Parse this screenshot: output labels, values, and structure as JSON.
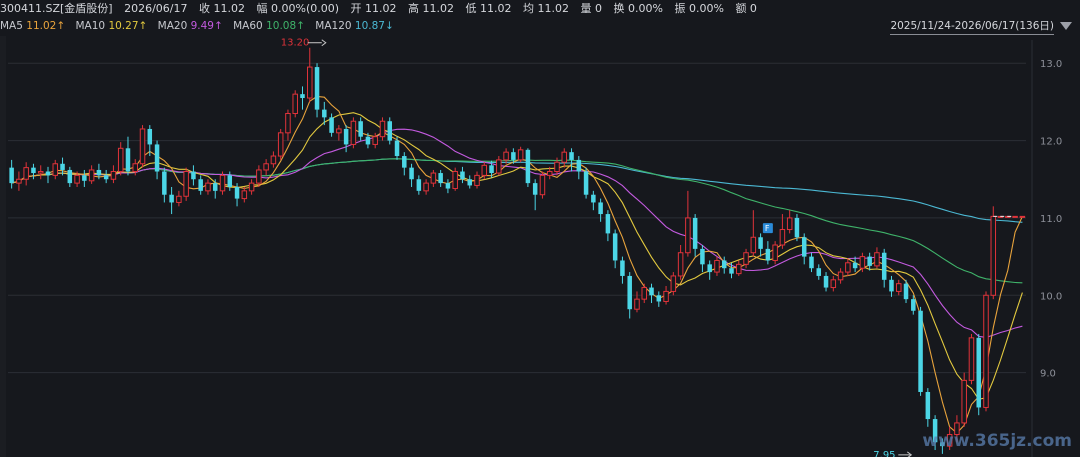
{
  "header": {
    "code": "300411.SZ[金盾股份]",
    "date": "2026/06/17",
    "close": "收 11.02",
    "change": "幅 0.00%(0.00)",
    "open": "开 11.02",
    "high": "高 11.02",
    "low": "低 11.02",
    "avg": "均 11.02",
    "volume": "量 0",
    "turnover": "换 0.00%",
    "amplitude": "振 0.00%",
    "amount": "额 0"
  },
  "ma_legend": [
    {
      "label": "MA5",
      "value": "11.02↑",
      "color": "#e8a33c"
    },
    {
      "label": "MA10",
      "value": "10.27↑",
      "color": "#e2c93f"
    },
    {
      "label": "MA20",
      "value": "9.49↑",
      "color": "#c35adf"
    },
    {
      "label": "MA60",
      "value": "10.08↑",
      "color": "#3fb36a"
    },
    {
      "label": "MA120",
      "value": "10.87↓",
      "color": "#4bb8d3"
    }
  ],
  "range_label": "2025/11/24-2026/06/17(136日)",
  "watermark": "www.365jz.com",
  "colors": {
    "up": "#e0333a",
    "down": "#4cd6e6",
    "grid": "#2b2e35",
    "background": "#16181d"
  },
  "chart_data": {
    "type": "candlestick",
    "ylim": [
      8.0,
      13.3
    ],
    "y_ticks": [
      {
        "value": 13.0,
        "label": "13.0"
      },
      {
        "value": 12.0,
        "label": "12.0"
      },
      {
        "value": 11.0,
        "label": "11.0"
      },
      {
        "value": 10.0,
        "label": "10.0"
      },
      {
        "value": 9.0,
        "label": "9.0"
      }
    ],
    "max_annotation": {
      "value": 13.2,
      "label": "13.20",
      "index": 41
    },
    "min_annotation": {
      "value": 7.95,
      "label": "7.95",
      "index": 124
    },
    "last_price": 11.02,
    "f_marker": {
      "index": 104,
      "label": "F"
    },
    "candles": [
      [
        11.65,
        11.45,
        11.75,
        11.38
      ],
      [
        11.45,
        11.5,
        11.6,
        11.35
      ],
      [
        11.5,
        11.65,
        11.72,
        11.42
      ],
      [
        11.65,
        11.58,
        11.7,
        11.5
      ],
      [
        11.58,
        11.6,
        11.68,
        11.5
      ],
      [
        11.6,
        11.55,
        11.66,
        11.45
      ],
      [
        11.55,
        11.7,
        11.75,
        11.5
      ],
      [
        11.7,
        11.62,
        11.78,
        11.55
      ],
      [
        11.62,
        11.45,
        11.66,
        11.4
      ],
      [
        11.45,
        11.55,
        11.6,
        11.4
      ],
      [
        11.55,
        11.48,
        11.62,
        11.4
      ],
      [
        11.48,
        11.62,
        11.68,
        11.44
      ],
      [
        11.62,
        11.55,
        11.7,
        11.5
      ],
      [
        11.55,
        11.5,
        11.62,
        11.45
      ],
      [
        11.5,
        11.6,
        11.68,
        11.45
      ],
      [
        11.6,
        11.9,
        11.98,
        11.55
      ],
      [
        11.9,
        11.6,
        12.05,
        11.55
      ],
      [
        11.6,
        11.7,
        11.76,
        11.55
      ],
      [
        11.7,
        12.15,
        12.2,
        11.65
      ],
      [
        12.15,
        11.95,
        12.2,
        11.8
      ],
      [
        11.95,
        11.6,
        12.0,
        11.5
      ],
      [
        11.6,
        11.3,
        11.65,
        11.2
      ],
      [
        11.3,
        11.2,
        11.4,
        11.05
      ],
      [
        11.2,
        11.28,
        11.35,
        11.15
      ],
      [
        11.28,
        11.6,
        11.65,
        11.22
      ],
      [
        11.6,
        11.5,
        11.68,
        11.42
      ],
      [
        11.5,
        11.35,
        11.55,
        11.3
      ],
      [
        11.35,
        11.45,
        11.5,
        11.3
      ],
      [
        11.45,
        11.35,
        11.5,
        11.25
      ],
      [
        11.35,
        11.55,
        11.6,
        11.3
      ],
      [
        11.55,
        11.4,
        11.6,
        11.35
      ],
      [
        11.4,
        11.25,
        11.45,
        11.15
      ],
      [
        11.25,
        11.35,
        11.4,
        11.2
      ],
      [
        11.35,
        11.45,
        11.5,
        11.3
      ],
      [
        11.45,
        11.62,
        11.68,
        11.4
      ],
      [
        11.62,
        11.7,
        11.76,
        11.55
      ],
      [
        11.7,
        11.8,
        11.86,
        11.65
      ],
      [
        11.8,
        12.1,
        12.15,
        11.75
      ],
      [
        12.1,
        12.35,
        12.4,
        12.0
      ],
      [
        12.35,
        12.6,
        12.65,
        12.3
      ],
      [
        12.6,
        12.55,
        12.7,
        12.4
      ],
      [
        12.55,
        12.95,
        13.2,
        12.5
      ],
      [
        12.95,
        12.4,
        13.0,
        12.3
      ],
      [
        12.4,
        12.3,
        12.5,
        12.2
      ],
      [
        12.3,
        12.1,
        12.35,
        12.05
      ],
      [
        12.1,
        12.15,
        12.2,
        12.0
      ],
      [
        12.15,
        11.95,
        12.2,
        11.85
      ],
      [
        11.95,
        12.25,
        12.3,
        11.9
      ],
      [
        12.25,
        12.05,
        12.3,
        12.0
      ],
      [
        12.05,
        11.95,
        12.1,
        11.9
      ],
      [
        11.95,
        12.05,
        12.1,
        11.9
      ],
      [
        12.05,
        12.25,
        12.3,
        12.0
      ],
      [
        12.25,
        12.0,
        12.3,
        11.95
      ],
      [
        12.0,
        11.8,
        12.05,
        11.75
      ],
      [
        11.8,
        11.65,
        11.85,
        11.55
      ],
      [
        11.65,
        11.5,
        11.7,
        11.4
      ],
      [
        11.5,
        11.35,
        11.55,
        11.3
      ],
      [
        11.35,
        11.45,
        11.5,
        11.3
      ],
      [
        11.45,
        11.58,
        11.62,
        11.4
      ],
      [
        11.58,
        11.45,
        11.62,
        11.4
      ],
      [
        11.45,
        11.38,
        11.5,
        11.32
      ],
      [
        11.38,
        11.6,
        11.65,
        11.35
      ],
      [
        11.6,
        11.5,
        11.66,
        11.45
      ],
      [
        11.5,
        11.42,
        11.55,
        11.38
      ],
      [
        11.42,
        11.55,
        11.6,
        11.38
      ],
      [
        11.55,
        11.68,
        11.72,
        11.5
      ],
      [
        11.68,
        11.58,
        11.74,
        11.52
      ],
      [
        11.58,
        11.75,
        11.8,
        11.55
      ],
      [
        11.75,
        11.85,
        11.9,
        11.7
      ],
      [
        11.85,
        11.75,
        11.9,
        11.7
      ],
      [
        11.75,
        11.88,
        11.92,
        11.72
      ],
      [
        11.88,
        11.45,
        11.9,
        11.4
      ],
      [
        11.45,
        11.3,
        11.5,
        11.1
      ],
      [
        11.3,
        11.55,
        11.6,
        11.25
      ],
      [
        11.55,
        11.6,
        11.66,
        11.5
      ],
      [
        11.6,
        11.72,
        11.78,
        11.55
      ],
      [
        11.72,
        11.85,
        11.9,
        11.65
      ],
      [
        11.85,
        11.75,
        11.9,
        11.6
      ],
      [
        11.75,
        11.6,
        11.8,
        11.5
      ],
      [
        11.6,
        11.3,
        11.65,
        11.25
      ],
      [
        11.3,
        11.2,
        11.35,
        11.1
      ],
      [
        11.2,
        11.05,
        11.25,
        10.95
      ],
      [
        11.05,
        10.8,
        11.1,
        10.7
      ],
      [
        10.8,
        10.45,
        10.85,
        10.35
      ],
      [
        10.45,
        10.25,
        10.5,
        10.15
      ],
      [
        10.25,
        9.82,
        10.3,
        9.7
      ],
      [
        9.82,
        9.95,
        10.05,
        9.78
      ],
      [
        9.95,
        10.1,
        10.15,
        9.9
      ],
      [
        10.1,
        10.0,
        10.15,
        9.9
      ],
      [
        10.0,
        9.92,
        10.05,
        9.85
      ],
      [
        9.92,
        10.05,
        10.12,
        9.88
      ],
      [
        10.05,
        10.25,
        10.3,
        10.0
      ],
      [
        10.25,
        10.55,
        10.65,
        10.2
      ],
      [
        10.55,
        11.0,
        11.35,
        10.5
      ],
      [
        11.0,
        10.6,
        11.05,
        10.5
      ],
      [
        10.6,
        10.4,
        10.65,
        10.3
      ],
      [
        10.4,
        10.3,
        10.45,
        10.2
      ],
      [
        10.3,
        10.45,
        10.5,
        10.25
      ],
      [
        10.45,
        10.35,
        10.5,
        10.28
      ],
      [
        10.35,
        10.28,
        10.42,
        10.22
      ],
      [
        10.28,
        10.4,
        10.45,
        10.25
      ],
      [
        10.4,
        10.55,
        10.6,
        10.35
      ],
      [
        10.55,
        10.75,
        11.1,
        10.5
      ],
      [
        10.75,
        10.6,
        10.8,
        10.5
      ],
      [
        10.6,
        10.45,
        10.7,
        10.4
      ],
      [
        10.45,
        10.65,
        10.7,
        10.4
      ],
      [
        10.65,
        10.85,
        11.05,
        10.6
      ],
      [
        10.85,
        11.0,
        11.1,
        10.8
      ],
      [
        11.0,
        10.75,
        11.05,
        10.7
      ],
      [
        10.75,
        10.5,
        10.8,
        10.4
      ],
      [
        10.5,
        10.35,
        10.55,
        10.3
      ],
      [
        10.35,
        10.25,
        10.4,
        10.2
      ],
      [
        10.25,
        10.1,
        10.3,
        10.05
      ],
      [
        10.1,
        10.2,
        10.25,
        10.05
      ],
      [
        10.2,
        10.3,
        10.35,
        10.15
      ],
      [
        10.3,
        10.42,
        10.48,
        10.25
      ],
      [
        10.42,
        10.35,
        10.5,
        10.3
      ],
      [
        10.35,
        10.5,
        10.55,
        10.3
      ],
      [
        10.5,
        10.38,
        10.55,
        10.32
      ],
      [
        10.38,
        10.55,
        10.62,
        10.35
      ],
      [
        10.55,
        10.2,
        10.6,
        10.1
      ],
      [
        10.2,
        10.05,
        10.25,
        9.98
      ],
      [
        10.05,
        10.15,
        10.2,
        10.0
      ],
      [
        10.15,
        9.95,
        10.2,
        9.9
      ],
      [
        9.95,
        9.8,
        10.0,
        9.75
      ],
      [
        9.8,
        8.75,
        9.85,
        8.7
      ],
      [
        8.75,
        8.4,
        8.8,
        8.3
      ],
      [
        8.4,
        8.1,
        8.45,
        8.0
      ],
      [
        8.1,
        8.05,
        8.15,
        7.95
      ],
      [
        8.05,
        8.2,
        8.3,
        8.0
      ],
      [
        8.2,
        8.35,
        8.45,
        8.1
      ],
      [
        8.35,
        8.9,
        9.0,
        8.3
      ],
      [
        8.9,
        9.45,
        9.5,
        8.85
      ],
      [
        9.45,
        8.55,
        9.5,
        8.45
      ],
      [
        8.55,
        10.0,
        10.05,
        8.5
      ],
      [
        10.0,
        11.02,
        11.15,
        9.95
      ],
      [
        11.02,
        11.02,
        11.02,
        11.02
      ],
      [
        11.02,
        11.02,
        11.02,
        11.02
      ],
      [
        11.02,
        11.02,
        11.02,
        11.02
      ],
      [
        11.02,
        11.02,
        11.02,
        11.02
      ]
    ]
  }
}
